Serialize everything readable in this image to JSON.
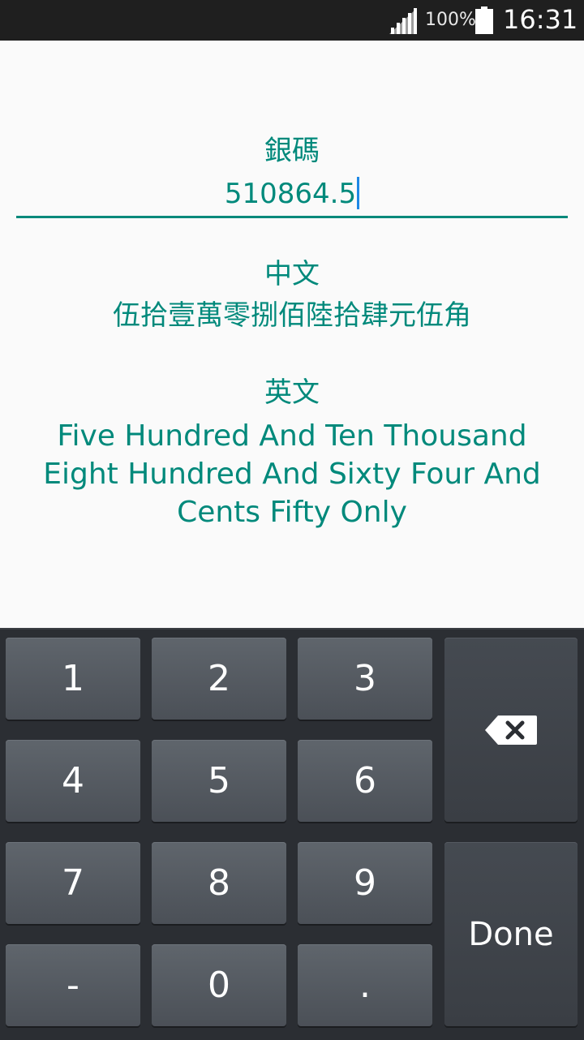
{
  "status_bar": {
    "battery_percent": "100%",
    "time": "16:31",
    "icons": [
      "signal-icon",
      "battery-icon"
    ]
  },
  "amount": {
    "label": "銀碼",
    "value": "510864.5"
  },
  "chinese": {
    "label": "中文",
    "value": "伍拾壹萬零捌佰陸拾肆元伍角"
  },
  "english": {
    "label": "英文",
    "lines": [
      "Five Hundred And Ten Thousand",
      "Eight Hundred And Sixty Four And",
      "Cents Fifty Only"
    ]
  },
  "keyboard": {
    "keys": [
      "1",
      "2",
      "3",
      "4",
      "5",
      "6",
      "7",
      "8",
      "9",
      "-",
      "0",
      "."
    ],
    "backspace_icon": "backspace-icon",
    "done_label": "Done"
  },
  "colors": {
    "accent": "#00897b",
    "cursor": "#1e88e5",
    "status_bar_bg": "#1f1f1f",
    "keyboard_bg": "#2b2e33"
  }
}
